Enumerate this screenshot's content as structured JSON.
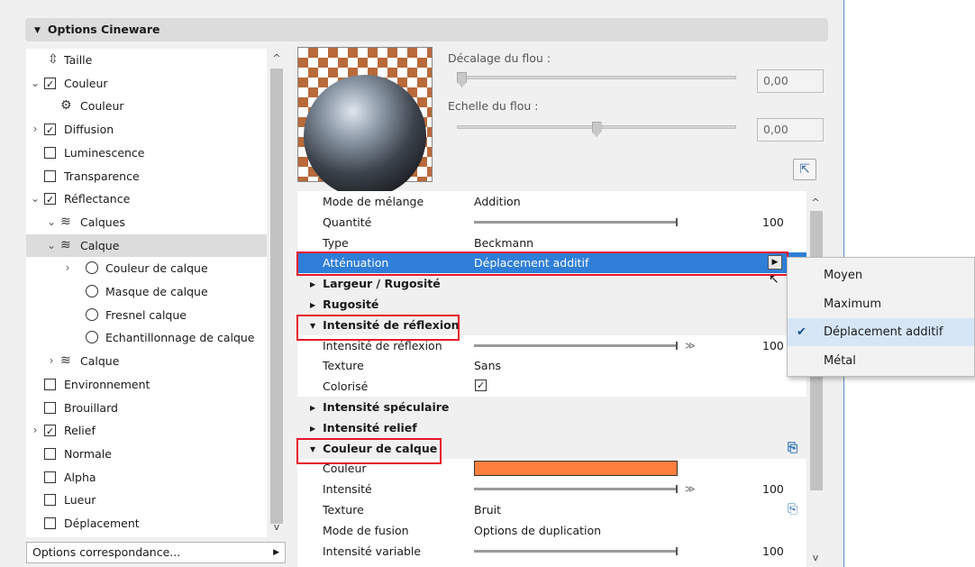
{
  "header": {
    "title": "Options Cineware"
  },
  "tree": {
    "items": [
      {
        "label": "Taille",
        "check": "none",
        "expander": "",
        "icon": "size-icon"
      },
      {
        "label": "Couleur",
        "check": "on",
        "expander": "expanded"
      },
      {
        "label": "Couleur",
        "check": "none",
        "expander": "",
        "icon": "channel-icon"
      },
      {
        "label": "Diffusion",
        "check": "on",
        "expander": "collapsed"
      },
      {
        "label": "Luminescence",
        "check": "off",
        "expander": ""
      },
      {
        "label": "Transparence",
        "check": "off",
        "expander": ""
      },
      {
        "label": "Réflectance",
        "check": "on",
        "expander": "expanded"
      },
      {
        "label": "Calques",
        "check": "none",
        "expander": "expanded",
        "icon": "layers-icon"
      },
      {
        "label": "Calque",
        "check": "none",
        "expander": "expanded",
        "icon": "layers-icon",
        "selected": true
      },
      {
        "label": "Couleur de calque",
        "check": "radio",
        "expander": "collapsed"
      },
      {
        "label": "Masque de calque",
        "check": "radio",
        "expander": ""
      },
      {
        "label": "Fresnel calque",
        "check": "radio",
        "expander": ""
      },
      {
        "label": "Echantillonnage de calque",
        "check": "radio",
        "expander": ""
      },
      {
        "label": "Calque",
        "check": "none",
        "expander": "collapsed",
        "icon": "layers-icon"
      },
      {
        "label": "Environnement",
        "check": "off",
        "expander": ""
      },
      {
        "label": "Brouillard",
        "check": "off",
        "expander": ""
      },
      {
        "label": "Relief",
        "check": "on",
        "expander": "collapsed"
      },
      {
        "label": "Normale",
        "check": "off",
        "expander": ""
      },
      {
        "label": "Alpha",
        "check": "off",
        "expander": ""
      },
      {
        "label": "Lueur",
        "check": "off",
        "expander": ""
      },
      {
        "label": "Déplacement",
        "check": "off",
        "expander": ""
      }
    ]
  },
  "options_row": {
    "label": "Options correspondance..."
  },
  "blur": {
    "offset_label": "Décalage du flou :",
    "offset_value": "0,00",
    "offset_level": 0.0,
    "scale_label": "Echelle du flou :",
    "scale_value": "0,00",
    "scale_level": 0.5
  },
  "properties": {
    "rows": [
      {
        "kind": "prop",
        "name": "Mode de mélange",
        "value": "Addition"
      },
      {
        "kind": "slider",
        "name": "Quantité",
        "number": "100"
      },
      {
        "kind": "prop",
        "name": "Type",
        "value": "Beckmann"
      },
      {
        "kind": "selected",
        "name": "Atténuation",
        "value": "Déplacement additif"
      },
      {
        "kind": "group",
        "name": "Largeur / Rugosité",
        "open": false
      },
      {
        "kind": "group",
        "name": "Rugosité",
        "open": false
      },
      {
        "kind": "group",
        "name": "Intensité de réflexion",
        "open": true
      },
      {
        "kind": "slider",
        "name": "Intensité de réflexion",
        "number": "100",
        "chevron": true
      },
      {
        "kind": "prop",
        "name": "Texture",
        "value": "Sans"
      },
      {
        "kind": "check",
        "name": "Colorisé",
        "checked": true
      },
      {
        "kind": "group",
        "name": "Intensité spéculaire",
        "open": false
      },
      {
        "kind": "group",
        "name": "Intensité relief",
        "open": false
      },
      {
        "kind": "group",
        "name": "Couleur de calque",
        "open": true,
        "icon": true
      },
      {
        "kind": "color",
        "name": "Couleur",
        "color": "#ff7f3f"
      },
      {
        "kind": "slider",
        "name": "Intensité",
        "number": "100",
        "chevron": true
      },
      {
        "kind": "prop",
        "name": "Texture",
        "value": "Bruit",
        "icon": true
      },
      {
        "kind": "prop",
        "name": "Mode de fusion",
        "value": "Options de duplication"
      },
      {
        "kind": "slider",
        "name": "Intensité variable",
        "number": "100"
      }
    ]
  },
  "dropdown": {
    "items": [
      {
        "label": "Moyen",
        "checked": false
      },
      {
        "label": "Maximum",
        "checked": false
      },
      {
        "label": "Déplacement additif",
        "checked": true
      },
      {
        "label": "Métal",
        "checked": false
      }
    ]
  },
  "colors": {
    "selection": "#2f7ed8",
    "highlight": "#e5162b",
    "layer_color": "#ff7f3f"
  }
}
